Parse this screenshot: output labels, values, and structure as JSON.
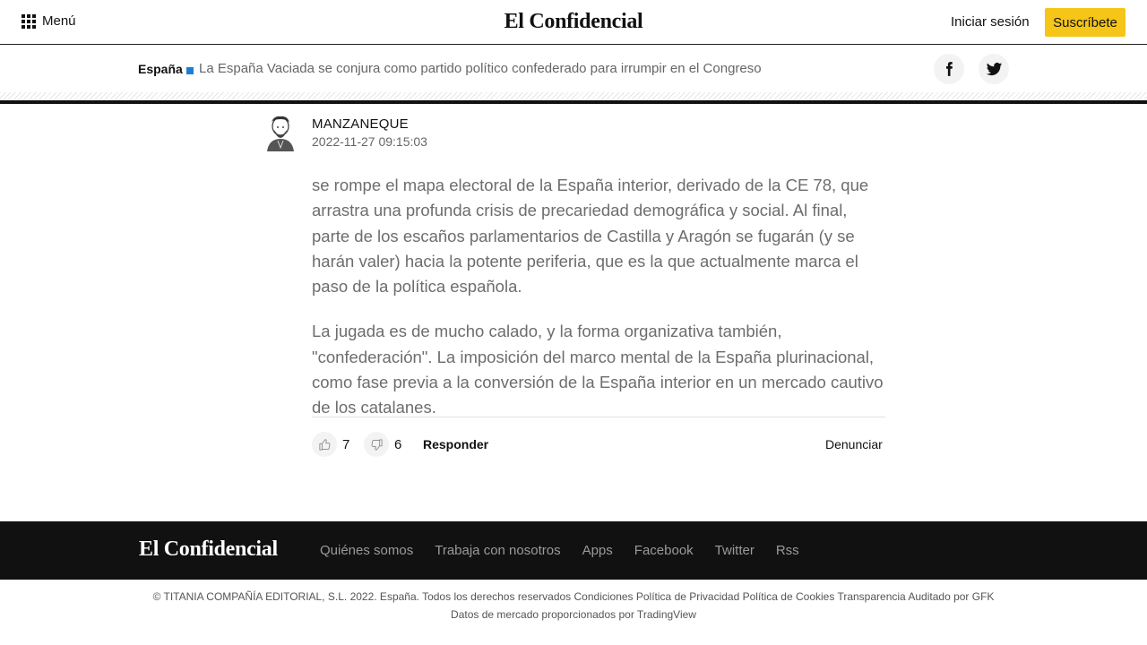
{
  "header": {
    "menu_label": "Menú",
    "logo": "El Confidencial",
    "login_label": "Iniciar sesión",
    "subscribe_label": "Suscríbete"
  },
  "article_bar": {
    "section": "España",
    "title": "La España Vaciada se conjura como partido político confederado para irrumpir en el Congreso",
    "share_icons": [
      "facebook-icon",
      "twitter-icon"
    ]
  },
  "comment": {
    "author": "MANZANEQUE",
    "date": "2022-11-27 09:15:03",
    "paragraphs": [
      "se rompe el mapa electoral de la España interior, derivado de la CE 78, que arrastra una profunda crisis de precariedad demográfica y social. Al final, parte de los escaños parlamentarios de Castilla y Aragón se fugarán (y se harán valer) hacia la potente periferia, que es la que actualmente marca el paso de la política española.",
      "La jugada es de mucho calado, y la forma organizativa también, \"confederación\". La imposición del marco mental de la España plurinacional, como fase previa a la conversión de la España interior en un mercado cautivo de los catalanes."
    ],
    "likes": "7",
    "dislikes": "6",
    "reply_label": "Responder",
    "report_label": "Denunciar"
  },
  "footer": {
    "logo": "El Confidencial",
    "links": [
      "Quiénes somos",
      "Trabaja con nosotros",
      "Apps",
      "Facebook",
      "Twitter",
      "Rss"
    ],
    "legal_line1": "© TITANIA COMPAÑÍA EDITORIAL, S.L. 2022. España. Todos los derechos reservados Condiciones Política de Privacidad Política de Cookies Transparencia Auditado por GFK",
    "legal_line2": "Datos de mercado proporcionados por TradingView"
  },
  "colors": {
    "accent_yellow": "#f5c518",
    "section_square": "#1a7fd4",
    "footer_bg": "#111111"
  }
}
